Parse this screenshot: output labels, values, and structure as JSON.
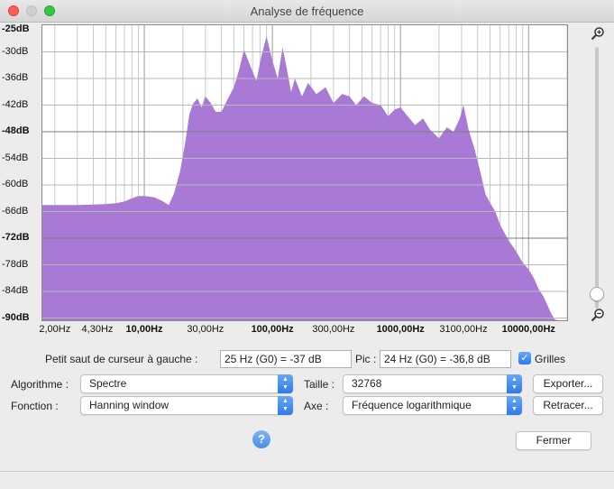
{
  "window": {
    "title": "Analyse de fréquence"
  },
  "chart_data": {
    "type": "area",
    "title": "",
    "xlabel": "",
    "ylabel": "",
    "x_scale": "log",
    "xlim": [
      1.6,
      20000
    ],
    "ylim": [
      -90.5,
      -24
    ],
    "grid": true,
    "fill_color": "#a87ad6",
    "y_ticks": [
      "-25dB",
      "-30dB",
      "-36dB",
      "-42dB",
      "-48dB",
      "-54dB",
      "-60dB",
      "-66dB",
      "-72dB",
      "-78dB",
      "-84dB",
      "-90dB"
    ],
    "y_tick_values": [
      -25,
      -30,
      -36,
      -42,
      -48,
      -54,
      -60,
      -66,
      -72,
      -78,
      -84,
      -90
    ],
    "x_ticks": [
      "2,00Hz",
      "4,30Hz",
      "10,00Hz",
      "30,00Hz",
      "100,00Hz",
      "300,00Hz",
      "1000,00Hz",
      "3100,00Hz",
      "10000,00Hz"
    ],
    "x_tick_values": [
      2,
      4.3,
      10,
      30,
      100,
      300,
      1000,
      3100,
      10000
    ],
    "series": [
      {
        "x": [
          1.6,
          3,
          4,
          5,
          6,
          7,
          8,
          9,
          10,
          12,
          14,
          15.5,
          17,
          19,
          21,
          22.5,
          24,
          26,
          28,
          30,
          33,
          36,
          40,
          45,
          50,
          55,
          60,
          68,
          75,
          82,
          90,
          100,
          110,
          120,
          130,
          140,
          150,
          170,
          190,
          220,
          260,
          300,
          350,
          400,
          450,
          520,
          600,
          700,
          800,
          900,
          1000,
          1100,
          1300,
          1500,
          1700,
          2000,
          2300,
          2600,
          2900,
          3100,
          3400,
          3800,
          4200,
          4600,
          5000,
          5500,
          6000,
          7000,
          8000,
          9000,
          10000,
          11000,
          12000,
          13000,
          14000,
          15000,
          16000,
          17000
        ],
        "y": [
          -64.5,
          -64.5,
          -64.4,
          -64.3,
          -64.1,
          -63.7,
          -63,
          -62.5,
          -62.5,
          -62.8,
          -63.7,
          -64.5,
          -62,
          -57,
          -50,
          -44,
          -41.7,
          -40.5,
          -42.5,
          -40,
          -41.5,
          -43.5,
          -43.5,
          -40.5,
          -38,
          -34,
          -29.5,
          -33.5,
          -36.5,
          -31,
          -26.5,
          -32,
          -36,
          -29,
          -34,
          -39,
          -36,
          -40,
          -37,
          -39.5,
          -38,
          -41.5,
          -39.5,
          -40,
          -42,
          -40,
          -41.5,
          -42,
          -44.5,
          -43,
          -42.5,
          -44,
          -46.5,
          -45,
          -47.5,
          -49.5,
          -47,
          -48,
          -45,
          -42,
          -47.5,
          -52,
          -57,
          -62,
          -64,
          -66,
          -69,
          -72.5,
          -75,
          -77.5,
          -79,
          -81,
          -83.5,
          -85,
          -87,
          -89,
          -90.3,
          -90.5
        ]
      }
    ]
  },
  "controls": {
    "cursor_label": "Petit saut de curseur à gauche :",
    "cursor_value": "25 Hz (G0) = -37 dB",
    "peak_label": "Pic :",
    "peak_value": "24 Hz (G0) = -36,8 dB",
    "grids_label": "Grilles",
    "grids_checked": true,
    "algorithm_label": "Algorithme :",
    "algorithm_value": "Spectre",
    "function_label": "Fonction :",
    "function_value": "Hanning window",
    "size_label": "Taille :",
    "size_value": "32768",
    "axis_label": "Axe :",
    "axis_value": "Fréquence logarithmique",
    "export_label": "Exporter...",
    "replot_label": "Retracer...",
    "close_label": "Fermer",
    "help_label": "?"
  }
}
